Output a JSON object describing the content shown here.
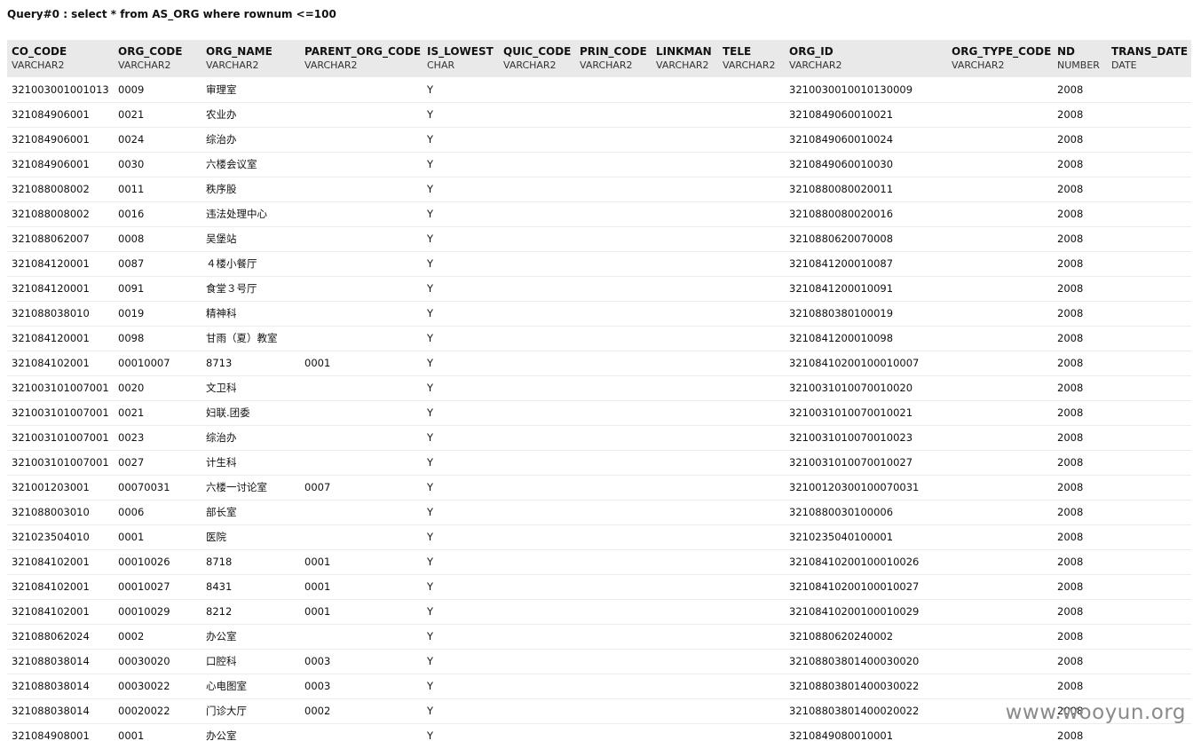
{
  "query": {
    "title": "Query#0 : select * from AS_ORG where rownum <=100"
  },
  "columns": [
    {
      "name": "CO_CODE",
      "type": "VARCHAR2"
    },
    {
      "name": "ORG_CODE",
      "type": "VARCHAR2"
    },
    {
      "name": "ORG_NAME",
      "type": "VARCHAR2"
    },
    {
      "name": "PARENT_ORG_CODE",
      "type": "VARCHAR2"
    },
    {
      "name": "IS_LOWEST",
      "type": "CHAR"
    },
    {
      "name": "QUIC_CODE",
      "type": "VARCHAR2"
    },
    {
      "name": "PRIN_CODE",
      "type": "VARCHAR2"
    },
    {
      "name": "LINKMAN",
      "type": "VARCHAR2"
    },
    {
      "name": "TELE",
      "type": "VARCHAR2"
    },
    {
      "name": "ORG_ID",
      "type": "VARCHAR2"
    },
    {
      "name": "ORG_TYPE_CODE",
      "type": "VARCHAR2"
    },
    {
      "name": "ND",
      "type": "NUMBER"
    },
    {
      "name": "TRANS_DATE",
      "type": "DATE"
    }
  ],
  "rows": [
    [
      "321003001001013",
      "0009",
      "审理室",
      "",
      "Y",
      "",
      "",
      "",
      "",
      "3210030010010130009",
      "",
      "2008",
      ""
    ],
    [
      "321084906001",
      "0021",
      "农业办",
      "",
      "Y",
      "",
      "",
      "",
      "",
      "3210849060010021",
      "",
      "2008",
      ""
    ],
    [
      "321084906001",
      "0024",
      "综治办",
      "",
      "Y",
      "",
      "",
      "",
      "",
      "3210849060010024",
      "",
      "2008",
      ""
    ],
    [
      "321084906001",
      "0030",
      "六楼会议室",
      "",
      "Y",
      "",
      "",
      "",
      "",
      "3210849060010030",
      "",
      "2008",
      ""
    ],
    [
      "321088008002",
      "0011",
      "秩序股",
      "",
      "Y",
      "",
      "",
      "",
      "",
      "3210880080020011",
      "",
      "2008",
      ""
    ],
    [
      "321088008002",
      "0016",
      "违法处理中心",
      "",
      "Y",
      "",
      "",
      "",
      "",
      "3210880080020016",
      "",
      "2008",
      ""
    ],
    [
      "321088062007",
      "0008",
      "吴堡站",
      "",
      "Y",
      "",
      "",
      "",
      "",
      "3210880620070008",
      "",
      "2008",
      ""
    ],
    [
      "321084120001",
      "0087",
      "４楼小餐厅",
      "",
      "Y",
      "",
      "",
      "",
      "",
      "3210841200010087",
      "",
      "2008",
      ""
    ],
    [
      "321084120001",
      "0091",
      "食堂３号厅",
      "",
      "Y",
      "",
      "",
      "",
      "",
      "3210841200010091",
      "",
      "2008",
      ""
    ],
    [
      "321088038010",
      "0019",
      "精神科",
      "",
      "Y",
      "",
      "",
      "",
      "",
      "3210880380100019",
      "",
      "2008",
      ""
    ],
    [
      "321084120001",
      "0098",
      "甘雨（夏）教室",
      "",
      "Y",
      "",
      "",
      "",
      "",
      "3210841200010098",
      "",
      "2008",
      ""
    ],
    [
      "321084102001",
      "00010007",
      "8713",
      "0001",
      "Y",
      "",
      "",
      "",
      "",
      "32108410200100010007",
      "",
      "2008",
      ""
    ],
    [
      "321003101007001",
      "0020",
      "文卫科",
      "",
      "Y",
      "",
      "",
      "",
      "",
      "3210031010070010020",
      "",
      "2008",
      ""
    ],
    [
      "321003101007001",
      "0021",
      "妇联.团委",
      "",
      "Y",
      "",
      "",
      "",
      "",
      "3210031010070010021",
      "",
      "2008",
      ""
    ],
    [
      "321003101007001",
      "0023",
      "综治办",
      "",
      "Y",
      "",
      "",
      "",
      "",
      "3210031010070010023",
      "",
      "2008",
      ""
    ],
    [
      "321003101007001",
      "0027",
      "计生科",
      "",
      "Y",
      "",
      "",
      "",
      "",
      "3210031010070010027",
      "",
      "2008",
      ""
    ],
    [
      "321001203001",
      "00070031",
      "六楼一讨论室",
      "0007",
      "Y",
      "",
      "",
      "",
      "",
      "32100120300100070031",
      "",
      "2008",
      ""
    ],
    [
      "321088003010",
      "0006",
      "部长室",
      "",
      "Y",
      "",
      "",
      "",
      "",
      "3210880030100006",
      "",
      "2008",
      ""
    ],
    [
      "321023504010",
      "0001",
      "医院",
      "",
      "Y",
      "",
      "",
      "",
      "",
      "3210235040100001",
      "",
      "2008",
      ""
    ],
    [
      "321084102001",
      "00010026",
      "8718",
      "0001",
      "Y",
      "",
      "",
      "",
      "",
      "32108410200100010026",
      "",
      "2008",
      ""
    ],
    [
      "321084102001",
      "00010027",
      "8431",
      "0001",
      "Y",
      "",
      "",
      "",
      "",
      "32108410200100010027",
      "",
      "2008",
      ""
    ],
    [
      "321084102001",
      "00010029",
      "8212",
      "0001",
      "Y",
      "",
      "",
      "",
      "",
      "32108410200100010029",
      "",
      "2008",
      ""
    ],
    [
      "321088062024",
      "0002",
      "办公室",
      "",
      "Y",
      "",
      "",
      "",
      "",
      "3210880620240002",
      "",
      "2008",
      ""
    ],
    [
      "321088038014",
      "00030020",
      "口腔科",
      "0003",
      "Y",
      "",
      "",
      "",
      "",
      "32108803801400030020",
      "",
      "2008",
      ""
    ],
    [
      "321088038014",
      "00030022",
      "心电图室",
      "0003",
      "Y",
      "",
      "",
      "",
      "",
      "32108803801400030022",
      "",
      "2008",
      ""
    ],
    [
      "321088038014",
      "00020022",
      "门诊大厅",
      "0002",
      "Y",
      "",
      "",
      "",
      "",
      "32108803801400020022",
      "",
      "2008",
      ""
    ],
    [
      "321084908001",
      "0001",
      "办公室",
      "",
      "Y",
      "",
      "",
      "",
      "",
      "3210849080010001",
      "",
      "2008",
      ""
    ]
  ],
  "watermark": "www.wooyun.org"
}
